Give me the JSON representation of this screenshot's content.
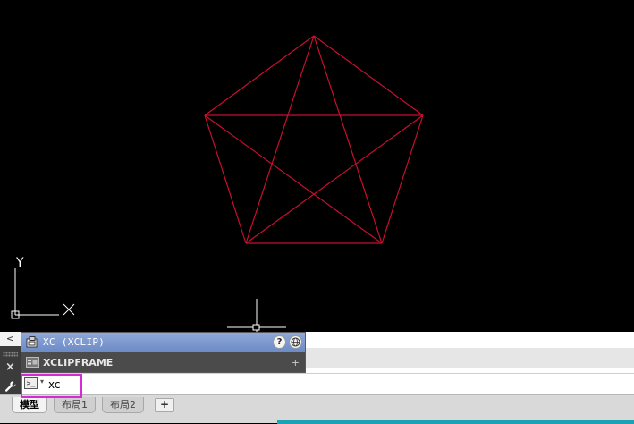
{
  "canvas": {
    "background": "#000000",
    "geometry_color": "#c8102e",
    "ucs_y_label": "Y",
    "ucs_x_label": "X"
  },
  "left_strip": {
    "collapse_glyph": "<",
    "close_glyph": "×",
    "customize_icon": "wrench-icon"
  },
  "autocomplete": {
    "items": [
      {
        "label": "XC (XCLIP)",
        "icon": "xclip-command-icon",
        "help_glyph": "?",
        "web_icon": "globe-icon"
      },
      {
        "label": "XCLIPFRAME",
        "icon": "system-variable-icon",
        "action_glyph": "+"
      }
    ]
  },
  "command_line": {
    "icon_glyph": ">_",
    "dropdown_glyph": "▾",
    "value": "xc",
    "highlight_color": "#d62ad4"
  },
  "layout_tabs": {
    "tabs": [
      {
        "label": "模型",
        "active": true
      },
      {
        "label": "布局1",
        "active": false
      },
      {
        "label": "布局2",
        "active": false
      }
    ],
    "add_glyph": "+"
  },
  "colors": {
    "panel_dark": "#3b3b3b",
    "highlight_blue": "#7d97cf",
    "status_accent": "#1aa3b5"
  }
}
